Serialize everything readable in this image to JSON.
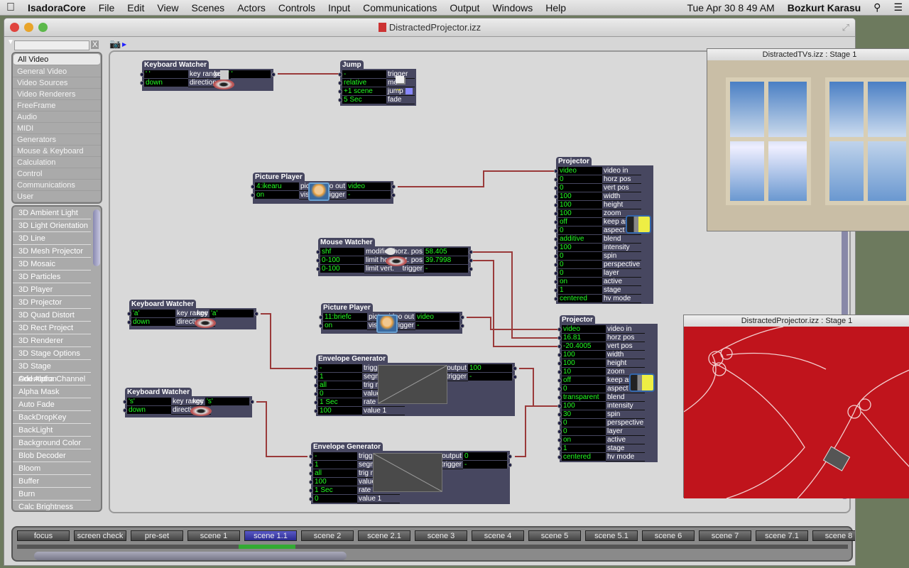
{
  "menubar": {
    "app": "IsadoraCore",
    "items": [
      "File",
      "Edit",
      "View",
      "Scenes",
      "Actors",
      "Controls",
      "Input",
      "Communications",
      "Output",
      "Windows",
      "Help"
    ],
    "clock": "Tue Apr 30  8 49 AM",
    "user": "Bozkurt Karasu"
  },
  "window": {
    "title": "DistractedProjector.izz",
    "search_clear": "X"
  },
  "categories": [
    "All Video",
    "General Video",
    "Video Sources",
    "Video Renderers",
    "FreeFrame",
    "Audio",
    "MIDI",
    "Generators",
    "Mouse & Keyboard",
    "Calculation",
    "Control",
    "Communications",
    "User"
  ],
  "actor_list": [
    "3D Ambient Light",
    "3D Light Orientation",
    "3D Line",
    "3D Mesh Projector",
    "3D Mosaic",
    "3D Particles",
    "3D Player",
    "3D Projector",
    "3D Quad Distort",
    "3D Rect Project",
    "3D Renderer",
    "3D Stage Options",
    "3D Stage Orientation",
    "Add Alpha Channel",
    "Alpha Mask",
    "Auto Fade",
    "BackDropKey",
    "BackLight",
    "Background Color",
    "Blob Decoder",
    "Bloom",
    "Buffer",
    "Burn",
    "Calc Brightness",
    "Chop Pixels"
  ],
  "actors": [
    {
      "title": "Keyboard Watcher",
      "icon": "eye-key-icon",
      "key_glyph": "",
      "inputs": [
        {
          "v": "' '",
          "l": "key range"
        },
        {
          "v": "down",
          "l": "direction"
        }
      ],
      "outputs": [
        {
          "l": "key",
          "v": "' '"
        }
      ]
    },
    {
      "title": "Jump",
      "icon": "jump-arrow-icon",
      "inputs": [
        {
          "v": "-",
          "l": "trigger"
        },
        {
          "v": "relative",
          "l": "mode"
        },
        {
          "v": "+1 scene",
          "l": "jump"
        },
        {
          "v": "5 Sec",
          "l": "fade"
        }
      ],
      "outputs": []
    },
    {
      "title": "Picture Player",
      "icon": "picture-thumbnail-icon",
      "inputs": [
        {
          "v": "4:ikearu",
          "l": "picture"
        },
        {
          "v": "on",
          "l": "visible"
        }
      ],
      "outputs": [
        {
          "l": "video out",
          "v": "video"
        },
        {
          "l": "trigger",
          "v": "-"
        }
      ]
    },
    {
      "title": "Projector",
      "icon": "projector-icon",
      "inputs": [
        {
          "v": "video",
          "l": "video in"
        },
        {
          "v": "0",
          "l": "horz pos"
        },
        {
          "v": "0",
          "l": "vert pos"
        },
        {
          "v": "100",
          "l": "width"
        },
        {
          "v": "100",
          "l": "height"
        },
        {
          "v": "100",
          "l": "zoom"
        },
        {
          "v": "off",
          "l": "keep aspect"
        },
        {
          "v": "0",
          "l": "aspect mod"
        },
        {
          "v": "additive",
          "l": "blend"
        },
        {
          "v": "100",
          "l": "intensity"
        },
        {
          "v": "0",
          "l": "spin"
        },
        {
          "v": "0",
          "l": "perspective"
        },
        {
          "v": "0",
          "l": "layer"
        },
        {
          "v": "on",
          "l": "active"
        },
        {
          "v": "1",
          "l": "stage"
        },
        {
          "v": "centered",
          "l": "hv mode"
        }
      ],
      "outputs": []
    },
    {
      "title": "Mouse Watcher",
      "icon": "mouse-eye-icon",
      "inputs": [
        {
          "v": "shf",
          "l": "modifiers"
        },
        {
          "v": "0-100",
          "l": "limit horz."
        },
        {
          "v": "0-100",
          "l": "limit vert."
        }
      ],
      "outputs": [
        {
          "l": "horz. pos",
          "v": "58.405"
        },
        {
          "l": "vert. pos",
          "v": "39.7998"
        },
        {
          "l": "trigger",
          "v": "-"
        }
      ]
    },
    {
      "title": "Keyboard Watcher",
      "icon": "eye-key-icon",
      "key_glyph": "a",
      "inputs": [
        {
          "v": "'a'",
          "l": "key range"
        },
        {
          "v": "down",
          "l": "direction"
        }
      ],
      "outputs": [
        {
          "l": "key",
          "v": "'a'"
        }
      ]
    },
    {
      "title": "Picture Player",
      "icon": "picture-thumbnail-icon",
      "inputs": [
        {
          "v": "11:briefc",
          "l": "picture"
        },
        {
          "v": "on",
          "l": "visible"
        }
      ],
      "outputs": [
        {
          "l": "video out",
          "v": "video"
        },
        {
          "l": "trigger",
          "v": "-"
        }
      ]
    },
    {
      "title": "Envelope Generator",
      "icon": "envelope-graph-rising",
      "inputs": [
        {
          "v": "-",
          "l": "trigger"
        },
        {
          "v": "1",
          "l": "segments"
        },
        {
          "v": "all",
          "l": "trig mode"
        },
        {
          "v": "0",
          "l": "value 0"
        },
        {
          "v": "1 Sec",
          "l": "rate 1"
        },
        {
          "v": "100",
          "l": "value 1"
        }
      ],
      "outputs": [
        {
          "l": "output",
          "v": "100"
        },
        {
          "l": "end trigger",
          "v": "-"
        }
      ]
    },
    {
      "title": "Keyboard Watcher",
      "icon": "eye-key-icon",
      "key_glyph": "s",
      "inputs": [
        {
          "v": "'s'",
          "l": "key range"
        },
        {
          "v": "down",
          "l": "direction"
        }
      ],
      "outputs": [
        {
          "l": "key",
          "v": "'s'"
        }
      ]
    },
    {
      "title": "Envelope Generator",
      "icon": "envelope-graph-falling",
      "inputs": [
        {
          "v": "-",
          "l": "trigger"
        },
        {
          "v": "1",
          "l": "segments"
        },
        {
          "v": "all",
          "l": "trig mode"
        },
        {
          "v": "100",
          "l": "value 0"
        },
        {
          "v": "1 Sec",
          "l": "rate 1"
        },
        {
          "v": "0",
          "l": "value 1"
        }
      ],
      "outputs": [
        {
          "l": "output",
          "v": "0"
        },
        {
          "l": "end trigger",
          "v": "-"
        }
      ]
    },
    {
      "title": "Projector",
      "icon": "projector-icon",
      "inputs": [
        {
          "v": "video",
          "l": "video in"
        },
        {
          "v": "16.81",
          "l": "horz pos"
        },
        {
          "v": "-20.4005",
          "l": "vert pos"
        },
        {
          "v": "100",
          "l": "width"
        },
        {
          "v": "100",
          "l": "height"
        },
        {
          "v": "10",
          "l": "zoom"
        },
        {
          "v": "off",
          "l": "keep aspect"
        },
        {
          "v": "0",
          "l": "aspect mod"
        },
        {
          "v": "transparent",
          "l": "blend"
        },
        {
          "v": "100",
          "l": "intensity"
        },
        {
          "v": "30",
          "l": "spin"
        },
        {
          "v": "0",
          "l": "perspective"
        },
        {
          "v": "0",
          "l": "layer"
        },
        {
          "v": "on",
          "l": "active"
        },
        {
          "v": "1",
          "l": "stage"
        },
        {
          "v": "centered",
          "l": "hv mode"
        }
      ],
      "outputs": []
    }
  ],
  "scenes": [
    "focus",
    "screen check",
    "pre-set",
    "scene 1",
    "scene 1.1",
    "scene 2",
    "scene 2.1",
    "scene 3",
    "scene 4",
    "scene 5",
    "scene 5.1",
    "scene 6",
    "scene 7",
    "scene 7.1",
    "scene 8"
  ],
  "active_scene": "scene 1.1",
  "stages": [
    {
      "title": "DistractedTVs.izz : Stage 1"
    },
    {
      "title": "DistractedProjector.izz : Stage 1"
    }
  ],
  "colors": {
    "actor_bg": "#474760",
    "value_text": "#22ff22",
    "wire": "#9a3a3a",
    "scene_active": "#3a3ab0",
    "stage2_bg": "#c0141c"
  }
}
